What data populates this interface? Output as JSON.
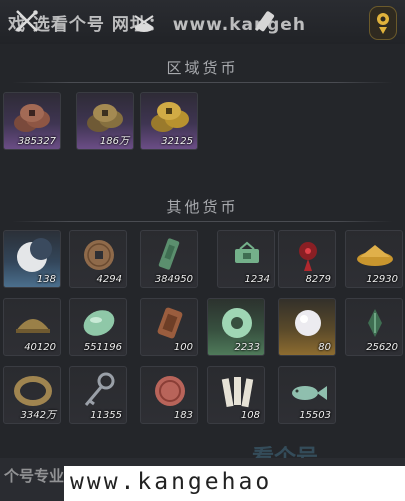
{
  "toolbar": {
    "banner_text": "戏 选看个号 网址： www.kangeh",
    "icons": [
      "crossed-swords-icon",
      "helmet-icon",
      "scroll-sword-icon",
      "gold-coin-icon"
    ]
  },
  "regional": {
    "title": "区域货币",
    "items": [
      {
        "name": "copper-coin-pile",
        "qty": "385327",
        "rarity": "purple"
      },
      {
        "name": "bronze-coin-pile",
        "qty": "186万",
        "rarity": "purple"
      },
      {
        "name": "gold-coin-pile",
        "qty": "32125",
        "rarity": "purple"
      }
    ]
  },
  "other": {
    "title": "其他货币",
    "items": [
      {
        "name": "crescent-jade",
        "qty": "138",
        "rarity": "blue"
      },
      {
        "name": "square-hole-coin",
        "qty": "4294",
        "rarity": "dark"
      },
      {
        "name": "jade-token",
        "qty": "384950",
        "rarity": "dark"
      },
      {
        "name": "jade-pendant",
        "qty": "1234",
        "rarity": "dark"
      },
      {
        "name": "red-flower-charm",
        "qty": "8279",
        "rarity": "dark"
      },
      {
        "name": "gold-grain",
        "qty": "12930",
        "rarity": "dark"
      },
      {
        "name": "bronze-dome",
        "qty": "40120",
        "rarity": "dark"
      },
      {
        "name": "green-jade-stone",
        "qty": "551196",
        "rarity": "dark"
      },
      {
        "name": "bronze-plaque",
        "qty": "100",
        "rarity": "dark"
      },
      {
        "name": "jade-ring-disc",
        "qty": "2233",
        "rarity": "green"
      },
      {
        "name": "white-pearl",
        "qty": "80",
        "rarity": "gold"
      },
      {
        "name": "green-leaf-charm",
        "qty": "25620",
        "rarity": "dark"
      },
      {
        "name": "bronze-bracelet",
        "qty": "3342万",
        "rarity": "dark"
      },
      {
        "name": "key-coin",
        "qty": "11355",
        "rarity": "dark"
      },
      {
        "name": "red-round-seal",
        "qty": "183",
        "rarity": "dark"
      },
      {
        "name": "bamboo-slips",
        "qty": "108",
        "rarity": "dark"
      },
      {
        "name": "jade-fish",
        "qty": "15503",
        "rarity": "dark"
      }
    ]
  },
  "footer": {
    "left_text": "个号专业网易游戏",
    "url_text": "www.kangehao",
    "watermark": "看个号"
  }
}
